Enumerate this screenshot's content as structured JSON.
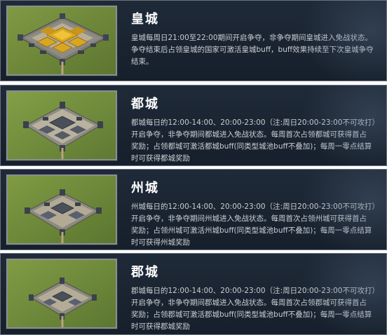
{
  "cities": [
    {
      "title": "皇城",
      "image_name": "imperial-city-image",
      "lines": [
        "皇城每周日21:00至22:00期间开启争夺，非争夺期间皇城进入免战状态。",
        "争夺结束后占领皇城的国家可激活皇城buff，buff效果持续至下次皇城争夺",
        "结束。"
      ]
    },
    {
      "title": "都城",
      "image_name": "capital-city-image",
      "lines": [
        "都城每日的12:00-14:00、20:00-23:00（注:周日20:00-23:00不可攻打）",
        "开启争夺，非争夺期间都城进入免战状态。每周首次占领都城可获得首占",
        "奖励；占领都城可激活都城buff(同类型城池buff不叠加)；每周一零点结算",
        "时可获得都城奖励"
      ]
    },
    {
      "title": "州城",
      "image_name": "prefecture-city-image",
      "lines": [
        "州城每日的12:00-14:00、20:00-23:00（注:周日20:00-23:00不可攻打）",
        "开启争夺，非争夺期间州城进入免战状态。每周首次占领州城可获得首占",
        "奖励；占领州城可激活州城buff(同类型城池buff不叠加)；每周一零点结算",
        "时可获得州城奖励"
      ]
    },
    {
      "title": "郡城",
      "image_name": "commandery-city-image",
      "lines": [
        "郡城每日的12:00-14:00、20:00-23:00（注:周日20:00-23:00不可攻打）",
        "开启争夺，非争夺期间郡城进入免战状态。每周首次占领郡城可获得首占",
        "奖励；占领郡城可激活郡城buff(同类型城池buff不叠加)；每周一零点结算",
        "时可获得郡城奖励"
      ]
    }
  ],
  "colors": {
    "panel_bg": "#1c2633",
    "title": "#ffffff",
    "text": "#c9cdd2",
    "grass": "#6f8a3a",
    "wall": "#9a9a92",
    "roof_gold": "#d9a620",
    "roof_dark": "#3a4048"
  }
}
